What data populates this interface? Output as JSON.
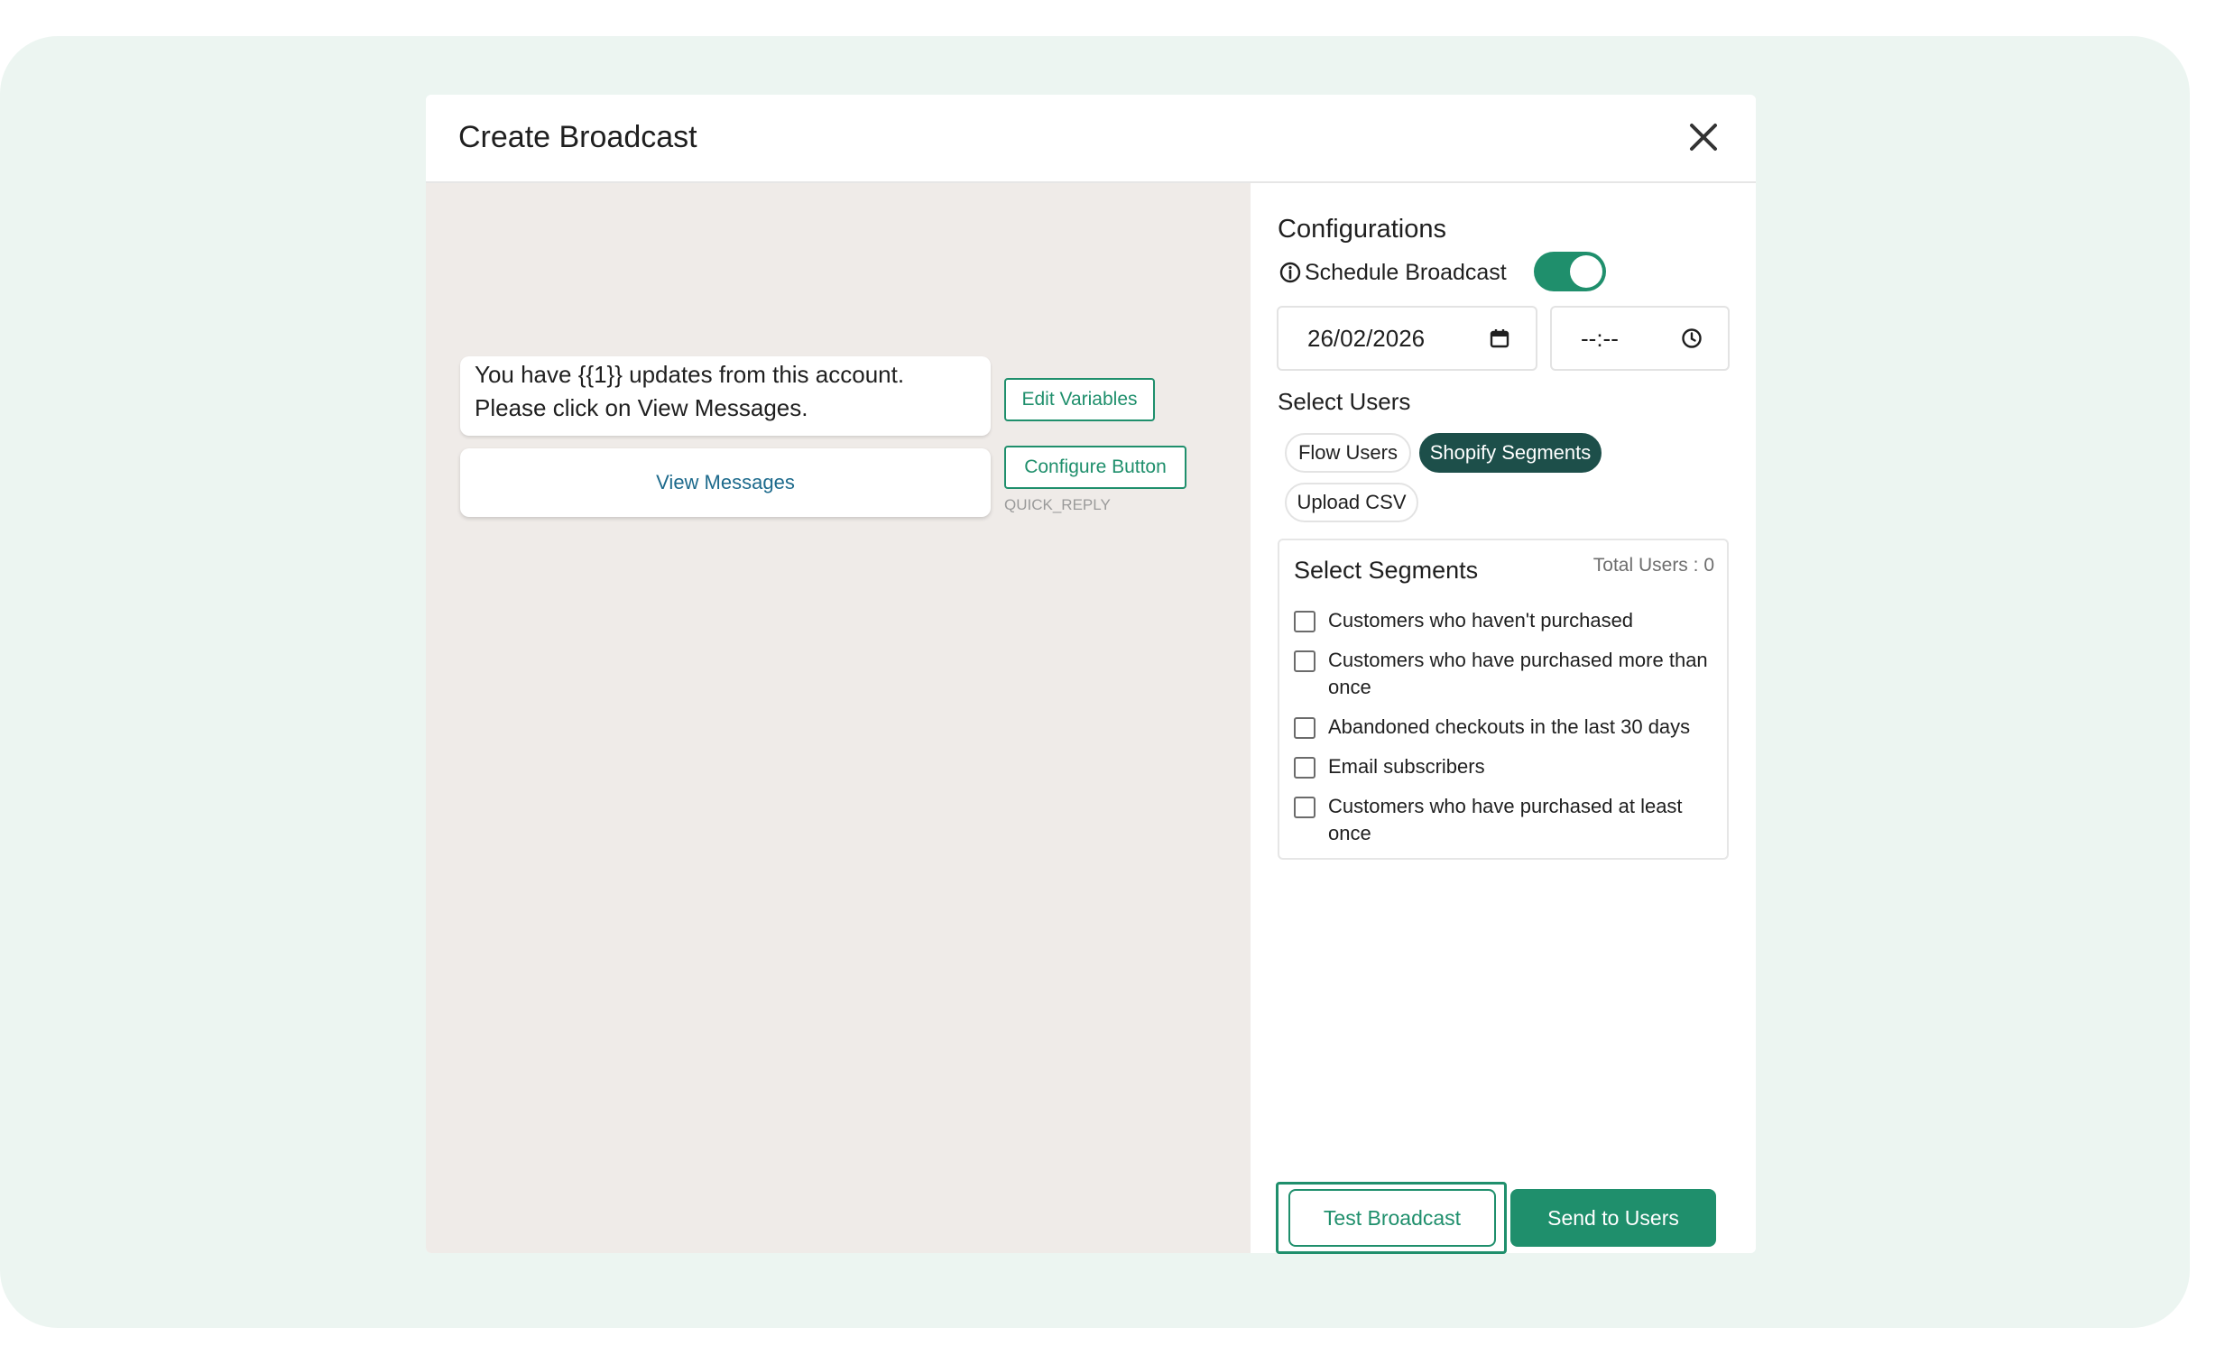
{
  "modal": {
    "title": "Create Broadcast",
    "close_icon": "close-icon"
  },
  "preview": {
    "message_text": "You have {{1}} updates from this account. Please click on View Messages.",
    "button_label": "View Messages",
    "edit_variables_label": "Edit Variables",
    "configure_button_label": "Configure Button",
    "button_type": "QUICK_REPLY"
  },
  "config": {
    "title": "Configurations",
    "schedule_label": "Schedule Broadcast",
    "schedule_enabled": true,
    "info_icon": "info-icon",
    "date_value": "26/02/2026",
    "date_icon": "calendar-icon",
    "time_value": "--:--",
    "time_icon": "clock-icon"
  },
  "users": {
    "title": "Select Users",
    "chips": [
      {
        "label": "Flow Users",
        "active": false
      },
      {
        "label": "Shopify Segments",
        "active": true
      },
      {
        "label": "Upload CSV",
        "active": false
      }
    ]
  },
  "segments": {
    "title": "Select Segments",
    "total_label": "Total Users : 0",
    "items": [
      {
        "label": "Customers who haven't purchased",
        "checked": false
      },
      {
        "label": "Customers who have purchased more than once",
        "checked": false
      },
      {
        "label": "Abandoned checkouts in the last 30 days",
        "checked": false
      },
      {
        "label": "Email subscribers",
        "checked": false
      },
      {
        "label": "Customers who have purchased at least once",
        "checked": false
      }
    ]
  },
  "actions": {
    "test_label": "Test Broadcast",
    "send_label": "Send to Users"
  },
  "colors": {
    "accent": "#1f8f6c",
    "active_chip": "#1d4f4a",
    "backdrop": "#ecf5f1",
    "preview_bg": "#efebe8"
  }
}
